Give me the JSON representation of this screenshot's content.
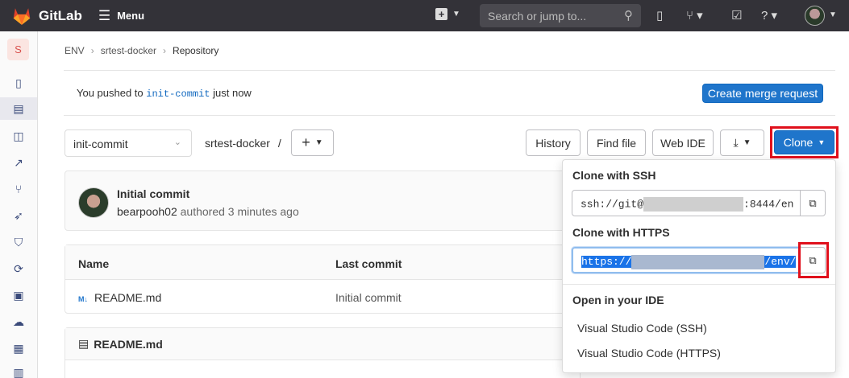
{
  "topbar": {
    "brand": "GitLab",
    "menu_label": "Menu",
    "search_placeholder": "Search or jump to...",
    "icons": [
      "plus-icon",
      "issues-icon",
      "merge-requests-icon",
      "todos-icon",
      "help-icon",
      "user-avatar"
    ]
  },
  "sidebar": {
    "project_initial": "S",
    "icons": [
      "project-overview-icon",
      "repository-icon",
      "issues-icon",
      "external-link-icon",
      "merge-requests-icon",
      "cicd-icon",
      "security-icon",
      "deployments-icon",
      "monitor-icon",
      "infrastructure-icon",
      "packages-icon",
      "analytics-icon"
    ]
  },
  "breadcrumb": [
    "ENV",
    "srtest-docker",
    "Repository"
  ],
  "push_notice": {
    "prefix": "You pushed to",
    "branch": "init-commit",
    "suffix": "just now",
    "button": "Create merge request"
  },
  "toolbar": {
    "branch": "init-commit",
    "path": "srtest-docker",
    "path_sep": "/",
    "add_symbol": "+",
    "history": "History",
    "find_file": "Find file",
    "web_ide": "Web IDE",
    "clone": "Clone"
  },
  "commit": {
    "title": "Initial commit",
    "author": "bearpooh02",
    "meta": "authored 3 minutes ago"
  },
  "files_table": {
    "columns": [
      "Name",
      "Last commit"
    ],
    "rows": [
      {
        "name": "README.md",
        "last_commit": "Initial commit"
      }
    ]
  },
  "readme": {
    "title": "README.md"
  },
  "clone_dropdown": {
    "ssh_label": "Clone with SSH",
    "ssh_prefix": "ssh://git@",
    "ssh_suffix": ":8444/en",
    "https_label": "Clone with HTTPS",
    "https_prefix": "https://",
    "https_suffix": "/env/",
    "ide_label": "Open in your IDE",
    "ide_options": [
      "Visual Studio Code (SSH)",
      "Visual Studio Code (HTTPS)"
    ]
  },
  "colors": {
    "accent": "#1f75cb",
    "highlight_frame": "#e0101c",
    "topbar": "#333238"
  }
}
